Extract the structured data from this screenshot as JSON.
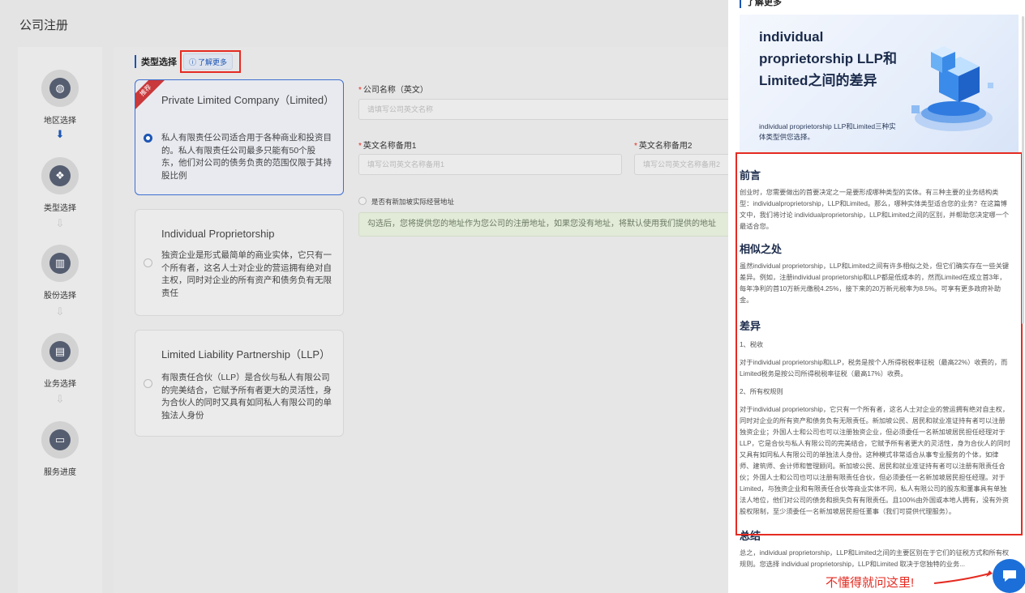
{
  "page": {
    "title": "公司注册"
  },
  "steps": [
    {
      "label": "地区选择",
      "icon": "globe-icon",
      "active": true
    },
    {
      "label": "类型选择",
      "icon": "cubes-icon",
      "active": true
    },
    {
      "label": "股份选择",
      "icon": "chart-icon",
      "active": false
    },
    {
      "label": "业务选择",
      "icon": "layout-icon",
      "active": false
    },
    {
      "label": "服务进度",
      "icon": "document-icon",
      "active": false
    }
  ],
  "section": {
    "title": "类型选择",
    "learn_more": "了解更多"
  },
  "cards": [
    {
      "ribbon": "推荐",
      "title": "Private Limited Company（Limited）",
      "desc": "私人有限责任公司适合用于各种商业和投资目的。私人有限责任公司最多只能有50个股东，他们对公司的债务负责的范围仅限于其持股比例",
      "selected": true
    },
    {
      "title": "Individual Proprietorship",
      "desc": "独资企业是形式最简单的商业实体，它只有一个所有者，这名人士对企业的营运拥有绝对自主权，同时对企业的所有资产和债务负有无限责任",
      "selected": false
    },
    {
      "title": "Limited Liability Partnership（LLP）",
      "desc": "有限责任合伙（LLP）是合伙与私人有限公司的完美结合，它赋予所有者更大的灵活性，身为合伙人的同时又具有如同私人有限公司的单独法人身份",
      "selected": false
    }
  ],
  "form": {
    "company_name_label": "公司名称（英文）",
    "company_name_placeholder": "请填写公司英文名称",
    "alt1_label": "英文名称备用1",
    "alt1_placeholder": "填写公司英文名称备用1",
    "alt2_label": "英文名称备用2",
    "alt2_placeholder": "填写公司英文名称备用2",
    "address_checkbox": "是否有新加坡实际经营地址",
    "notice": "勾选后，您将提供您的地址作为您公司的注册地址，如果您没有地址，将默认使用我们提供的地址"
  },
  "drawer": {
    "header": "了解更多",
    "banner_title": "individual proprietorship LLP和Limited之间的差异",
    "banner_sub": "individual proprietorship LLP和Limited三种实体类型供您选择。",
    "h_intro": "前言",
    "p_intro": "创业时，您需要做出的首要决定之一是要形成哪种类型的实体。有三种主要的业务结构类型：individualproprietorship，LLP和Limited。那么，哪种实体类型适合您的业务？在这篇博文中，我们将讨论 individualproprietorship，LLP和Limited之间的区别，并帮助您决定哪一个最适合您。",
    "h_similar": "相似之处",
    "p_similar": "虽然individual proprietorship，LLP和Limited之间有许多相似之处，但它们确实存在一些关键差异。例如，注册individual proprietorship和LLP都是低成本的，然而Limited在成立首3年，每年净利的首10万新元缴税4.25%，接下来的20万新元税率为8.5%。可享有更多政府补助金。",
    "h_diff": "差异",
    "sub_tax": "1、税收",
    "p_tax": "对于individual proprietorship和LLP，税务是按个人所得税税率征税（最高22%）收费的，而Limited税务是按公司所得税税率征税（最高17%）收费。",
    "sub_owner": "2、所有权规则",
    "p_owner": "对于individual proprietorship，它只有一个所有者，这名人士对企业的营运拥有绝对自主权，同时对企业的所有资产和债务负有无限责任。新加坡公民、居民和就业准证持有者可以注册独资企业；外国人士和公司也可以注册独资企业，但必须委任一名新加坡居民担任经理对于LLP，它是合伙与私人有限公司的完美结合，它赋予所有者更大的灵活性，身为合伙人的同时又具有如同私人有限公司的单独法人身份。这种模式非常适合从事专业服务的个体，如律师、建筑师、会计师和管理顾问。新加坡公民、居民和就业准证持有者可以注册有限责任合伙；外国人士和公司也可以注册有限责任合伙，但必须委任一名新加坡居民担任经理。对于Limited，与独资企业和有限责任合伙等商业实体不同，私人有限公司的股东和董事具有单独法人地位，他们对公司的债务和损失负有有限责任。且100%由外国或本地人拥有，没有外资股权限制，至少须委任一名新加坡居民担任董事（我们可提供代理服务）。",
    "h_summary": "总结",
    "p_summary": "总之，individual proprietorship，LLP和Limited之间的主要区别在于它们的征税方式和所有权规则。您选择 individual proprietorship，LLP和Limited 取决于您独特的业务..."
  },
  "annotation": "不懂得就问这里!",
  "colors": {
    "accent": "#1c55b4",
    "annotation_red": "#e52b22",
    "ribbon": "#c9383a"
  }
}
